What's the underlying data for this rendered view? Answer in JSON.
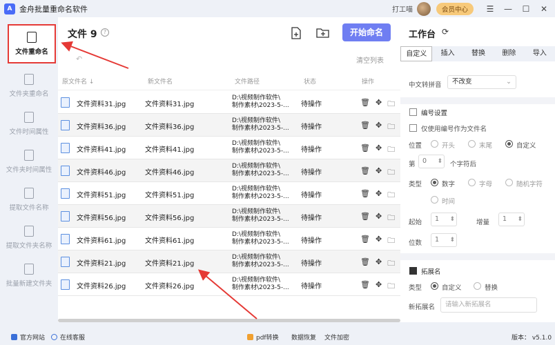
{
  "window": {
    "logo_text": "A",
    "title": "金舟批量重命名软件",
    "user_name": "打工喵",
    "vip_label": "会员中心",
    "controls": [
      "☰",
      "—",
      "☐",
      "✕"
    ]
  },
  "sidebar": {
    "items": [
      {
        "label": "文件重命名",
        "icon": "file-edit-icon"
      },
      {
        "label": "文件夹重命名",
        "icon": "folder-edit-icon"
      },
      {
        "label": "文件时间属性",
        "icon": "file-clock-icon"
      },
      {
        "label": "文件夹时间属性",
        "icon": "folder-clock-icon"
      },
      {
        "label": "提取文件名称",
        "icon": "file-extract-icon"
      },
      {
        "label": "提取文件夹名称",
        "icon": "folder-extract-icon"
      },
      {
        "label": "批量新建文件夹",
        "icon": "folder-create-icon"
      }
    ]
  },
  "main": {
    "title": "文件 9",
    "help": "?",
    "start_button": "开始命名",
    "clear_list": "清空列表",
    "columns": {
      "original": "原文件名 ↓",
      "new": "新文件名",
      "path": "文件路径",
      "status": "状态",
      "ops": "操作"
    },
    "rows": [
      {
        "orig": "文件资料31.jpg",
        "new": "文件资料31.jpg",
        "path1": "D:\\视频制作软件\\",
        "path2": "制作素材\\2023-5-...",
        "status": "待操作"
      },
      {
        "orig": "文件资料36.jpg",
        "new": "文件资料36.jpg",
        "path1": "D:\\视频制作软件\\",
        "path2": "制作素材\\2023-5-...",
        "status": "待操作"
      },
      {
        "orig": "文件资料41.jpg",
        "new": "文件资料41.jpg",
        "path1": "D:\\视频制作软件\\",
        "path2": "制作素材\\2023-5-...",
        "status": "待操作"
      },
      {
        "orig": "文件资料46.jpg",
        "new": "文件资料46.jpg",
        "path1": "D:\\视频制作软件\\",
        "path2": "制作素材\\2023-5-...",
        "status": "待操作"
      },
      {
        "orig": "文件资料51.jpg",
        "new": "文件资料51.jpg",
        "path1": "D:\\视频制作软件\\",
        "path2": "制作素材\\2023-5-...",
        "status": "待操作"
      },
      {
        "orig": "文件资料56.jpg",
        "new": "文件资料56.jpg",
        "path1": "D:\\视频制作软件\\",
        "path2": "制作素材\\2023-5-...",
        "status": "待操作"
      },
      {
        "orig": "文件资料61.jpg",
        "new": "文件资料61.jpg",
        "path1": "D:\\视频制作软件\\",
        "path2": "制作素材\\2023-5-...",
        "status": "待操作"
      },
      {
        "orig": "文件资料21.jpg",
        "new": "文件资料21.jpg",
        "path1": "D:\\视频制作软件\\",
        "path2": "制作素材\\2023-5-...",
        "status": "待操作"
      },
      {
        "orig": "文件资料26.jpg",
        "new": "文件资料26.jpg",
        "path1": "D:\\视频制作软件\\",
        "path2": "制作素材\\2023-5-...",
        "status": "待操作"
      }
    ]
  },
  "panel": {
    "title": "工作台",
    "tabs": [
      "自定义",
      "插入",
      "替换",
      "删除",
      "导入"
    ],
    "pinyin_label": "中文转拼音",
    "pinyin_value": "不改变",
    "numbering_label": "编号设置",
    "only_number_label": "仅使用编号作为文件名",
    "position_label": "位置",
    "position_options": [
      "开头",
      "末尾",
      "自定义"
    ],
    "nth_label": "第",
    "nth_value": "0",
    "nth_suffix": "个字符后",
    "type_label": "类型",
    "type_options": [
      "数字",
      "字母",
      "随机字符",
      "时间"
    ],
    "start_label": "起始",
    "start_value": "1",
    "step_label": "增量",
    "step_value": "1",
    "digits_label": "位数",
    "digits_value": "1",
    "ext_label": "拓展名",
    "ext_type_label": "类型",
    "ext_type_options": [
      "自定义",
      "替换"
    ],
    "new_ext_label": "新拓展名",
    "new_ext_placeholder": "请输入新拓展名"
  },
  "status": {
    "website": "官方网站",
    "support": "在线客服",
    "pdf": "pdf转换",
    "recovery": "数据恢复",
    "encrypt": "文件加密",
    "version": "版本： v5.1.0"
  },
  "colors": {
    "accent": "#6f7ef2",
    "annotation": "#e53935",
    "vip": "#f7c97a"
  }
}
